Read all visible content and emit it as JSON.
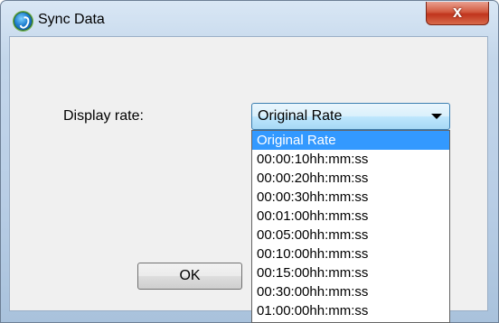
{
  "window": {
    "title": "Sync Data",
    "close_glyph": "x"
  },
  "form": {
    "rate_label": "Display rate:",
    "combo_value": "Original Rate",
    "ok_label": "OK"
  },
  "dropdown": {
    "selected_index": 0,
    "options": [
      "Original Rate",
      "00:00:10hh:mm:ss",
      "00:00:20hh:mm:ss",
      "00:00:30hh:mm:ss",
      "00:01:00hh:mm:ss",
      "00:05:00hh:mm:ss",
      "00:10:00hh:mm:ss",
      "00:15:00hh:mm:ss",
      "00:30:00hh:mm:ss",
      "01:00:00hh:mm:ss"
    ]
  },
  "icons": {
    "app": "sync-app-icon",
    "close": "close-icon",
    "combo": "chevron-down-icon"
  },
  "colors": {
    "selection": "#3399ff",
    "close_button": "#c0341d"
  }
}
